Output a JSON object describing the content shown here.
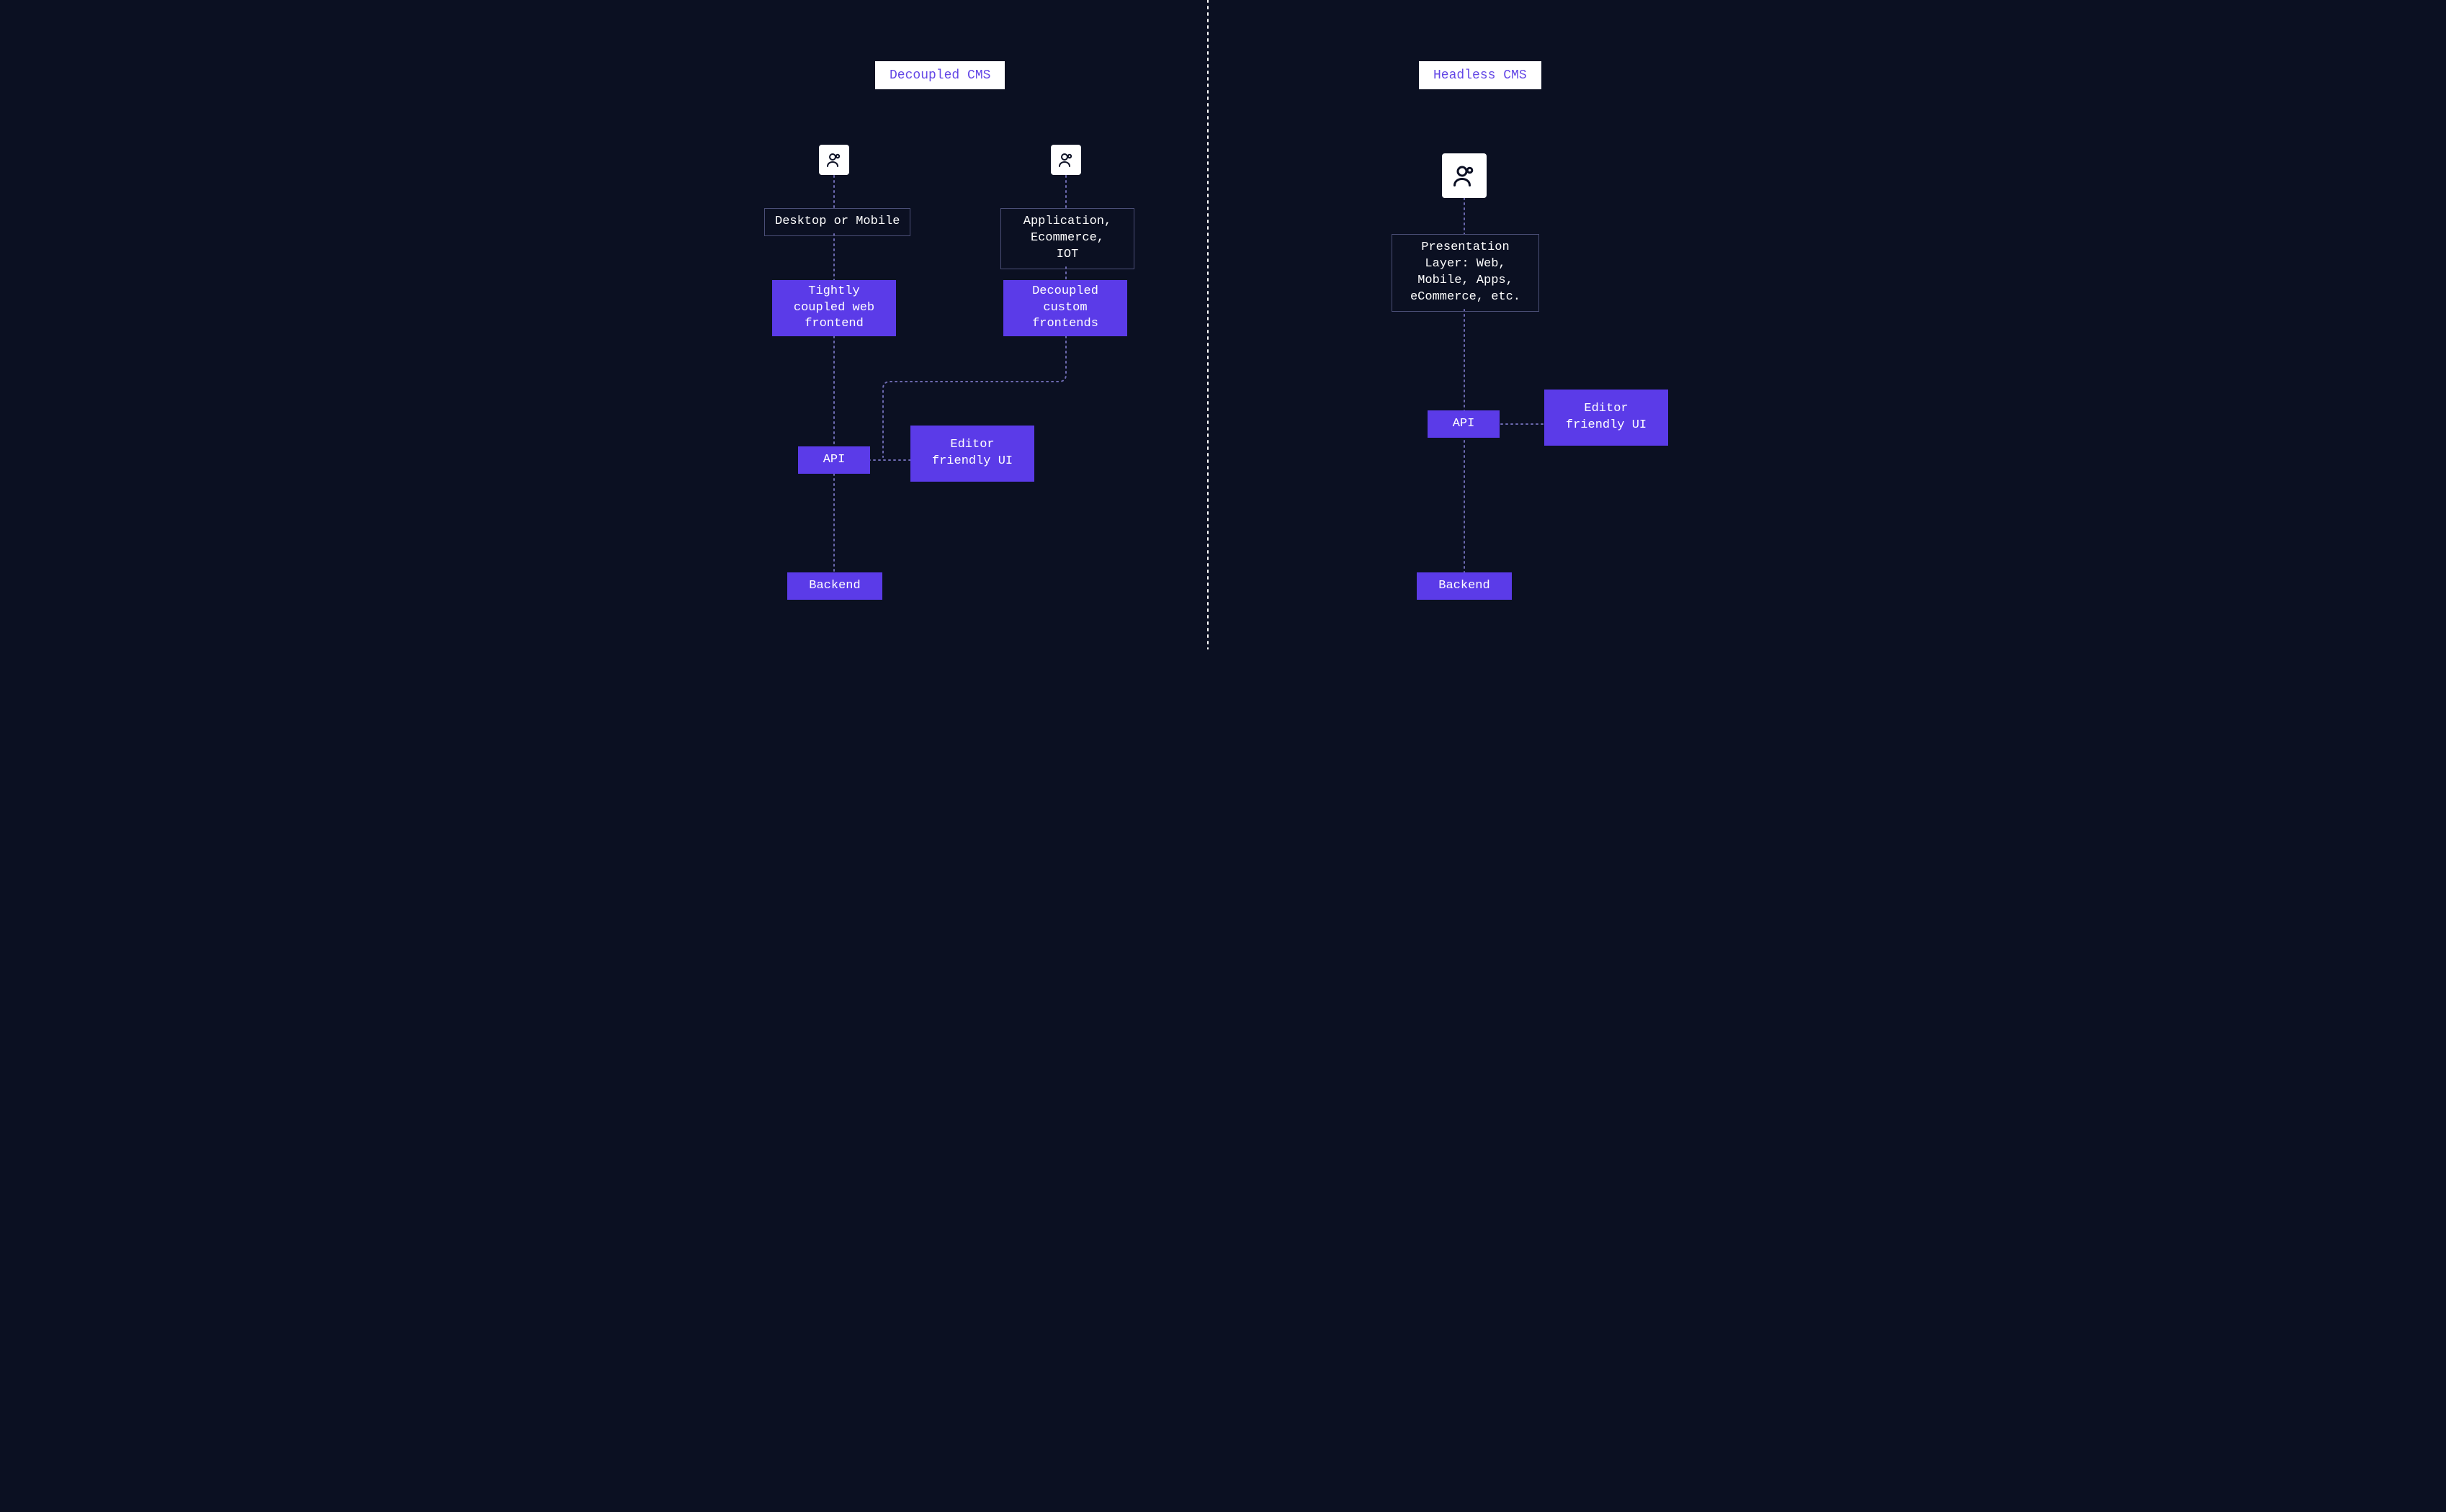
{
  "left": {
    "title": "Decoupled CMS",
    "users1_icon": "users-icon",
    "users2_icon": "users-icon",
    "platform1": "Desktop or Mobile",
    "platform2": "Application,\nEcommerce,\nIOT",
    "frontend1": "Tightly\ncoupled web\nfrontend",
    "frontend2": "Decoupled\ncustom\nfrontends",
    "api": "API",
    "editor": "Editor\nfriendly UI",
    "backend": "Backend"
  },
  "right": {
    "title": "Headless CMS",
    "users_icon": "users-icon",
    "presentation": "Presentation\nLayer: Web,\nMobile, Apps,\neCommerce, etc.",
    "api": "API",
    "editor": "Editor\nfriendly UI",
    "backend": "Backend"
  },
  "colors": {
    "background": "#0b1022",
    "purple": "#5b3be8",
    "white": "#ffffff"
  }
}
